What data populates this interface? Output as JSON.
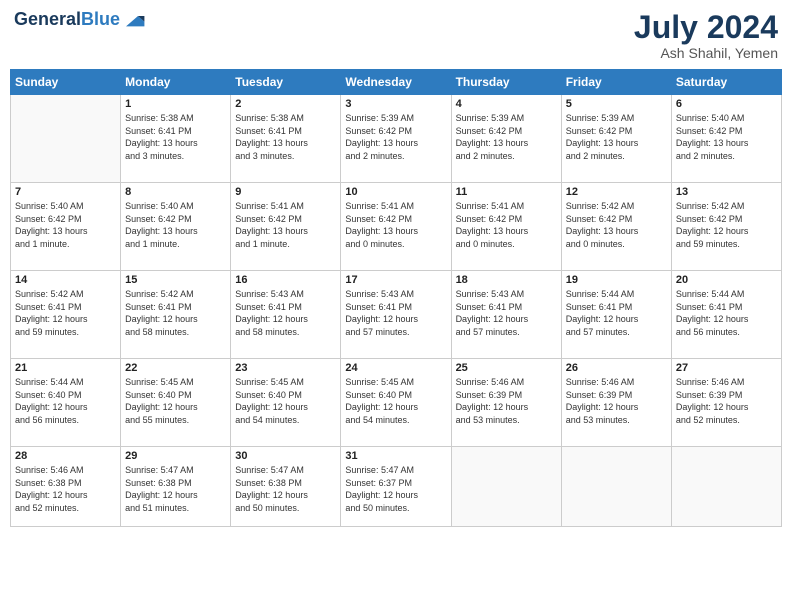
{
  "header": {
    "logo_line1": "General",
    "logo_line2": "Blue",
    "month": "July 2024",
    "location": "Ash Shahil, Yemen"
  },
  "days_of_week": [
    "Sunday",
    "Monday",
    "Tuesday",
    "Wednesday",
    "Thursday",
    "Friday",
    "Saturday"
  ],
  "weeks": [
    [
      {
        "day": "",
        "info": ""
      },
      {
        "day": "1",
        "info": "Sunrise: 5:38 AM\nSunset: 6:41 PM\nDaylight: 13 hours\nand 3 minutes."
      },
      {
        "day": "2",
        "info": "Sunrise: 5:38 AM\nSunset: 6:41 PM\nDaylight: 13 hours\nand 3 minutes."
      },
      {
        "day": "3",
        "info": "Sunrise: 5:39 AM\nSunset: 6:42 PM\nDaylight: 13 hours\nand 2 minutes."
      },
      {
        "day": "4",
        "info": "Sunrise: 5:39 AM\nSunset: 6:42 PM\nDaylight: 13 hours\nand 2 minutes."
      },
      {
        "day": "5",
        "info": "Sunrise: 5:39 AM\nSunset: 6:42 PM\nDaylight: 13 hours\nand 2 minutes."
      },
      {
        "day": "6",
        "info": "Sunrise: 5:40 AM\nSunset: 6:42 PM\nDaylight: 13 hours\nand 2 minutes."
      }
    ],
    [
      {
        "day": "7",
        "info": "Sunrise: 5:40 AM\nSunset: 6:42 PM\nDaylight: 13 hours\nand 1 minute."
      },
      {
        "day": "8",
        "info": "Sunrise: 5:40 AM\nSunset: 6:42 PM\nDaylight: 13 hours\nand 1 minute."
      },
      {
        "day": "9",
        "info": "Sunrise: 5:41 AM\nSunset: 6:42 PM\nDaylight: 13 hours\nand 1 minute."
      },
      {
        "day": "10",
        "info": "Sunrise: 5:41 AM\nSunset: 6:42 PM\nDaylight: 13 hours\nand 0 minutes."
      },
      {
        "day": "11",
        "info": "Sunrise: 5:41 AM\nSunset: 6:42 PM\nDaylight: 13 hours\nand 0 minutes."
      },
      {
        "day": "12",
        "info": "Sunrise: 5:42 AM\nSunset: 6:42 PM\nDaylight: 13 hours\nand 0 minutes."
      },
      {
        "day": "13",
        "info": "Sunrise: 5:42 AM\nSunset: 6:42 PM\nDaylight: 12 hours\nand 59 minutes."
      }
    ],
    [
      {
        "day": "14",
        "info": "Sunrise: 5:42 AM\nSunset: 6:41 PM\nDaylight: 12 hours\nand 59 minutes."
      },
      {
        "day": "15",
        "info": "Sunrise: 5:42 AM\nSunset: 6:41 PM\nDaylight: 12 hours\nand 58 minutes."
      },
      {
        "day": "16",
        "info": "Sunrise: 5:43 AM\nSunset: 6:41 PM\nDaylight: 12 hours\nand 58 minutes."
      },
      {
        "day": "17",
        "info": "Sunrise: 5:43 AM\nSunset: 6:41 PM\nDaylight: 12 hours\nand 57 minutes."
      },
      {
        "day": "18",
        "info": "Sunrise: 5:43 AM\nSunset: 6:41 PM\nDaylight: 12 hours\nand 57 minutes."
      },
      {
        "day": "19",
        "info": "Sunrise: 5:44 AM\nSunset: 6:41 PM\nDaylight: 12 hours\nand 57 minutes."
      },
      {
        "day": "20",
        "info": "Sunrise: 5:44 AM\nSunset: 6:41 PM\nDaylight: 12 hours\nand 56 minutes."
      }
    ],
    [
      {
        "day": "21",
        "info": "Sunrise: 5:44 AM\nSunset: 6:40 PM\nDaylight: 12 hours\nand 56 minutes."
      },
      {
        "day": "22",
        "info": "Sunrise: 5:45 AM\nSunset: 6:40 PM\nDaylight: 12 hours\nand 55 minutes."
      },
      {
        "day": "23",
        "info": "Sunrise: 5:45 AM\nSunset: 6:40 PM\nDaylight: 12 hours\nand 54 minutes."
      },
      {
        "day": "24",
        "info": "Sunrise: 5:45 AM\nSunset: 6:40 PM\nDaylight: 12 hours\nand 54 minutes."
      },
      {
        "day": "25",
        "info": "Sunrise: 5:46 AM\nSunset: 6:39 PM\nDaylight: 12 hours\nand 53 minutes."
      },
      {
        "day": "26",
        "info": "Sunrise: 5:46 AM\nSunset: 6:39 PM\nDaylight: 12 hours\nand 53 minutes."
      },
      {
        "day": "27",
        "info": "Sunrise: 5:46 AM\nSunset: 6:39 PM\nDaylight: 12 hours\nand 52 minutes."
      }
    ],
    [
      {
        "day": "28",
        "info": "Sunrise: 5:46 AM\nSunset: 6:38 PM\nDaylight: 12 hours\nand 52 minutes."
      },
      {
        "day": "29",
        "info": "Sunrise: 5:47 AM\nSunset: 6:38 PM\nDaylight: 12 hours\nand 51 minutes."
      },
      {
        "day": "30",
        "info": "Sunrise: 5:47 AM\nSunset: 6:38 PM\nDaylight: 12 hours\nand 50 minutes."
      },
      {
        "day": "31",
        "info": "Sunrise: 5:47 AM\nSunset: 6:37 PM\nDaylight: 12 hours\nand 50 minutes."
      },
      {
        "day": "",
        "info": ""
      },
      {
        "day": "",
        "info": ""
      },
      {
        "day": "",
        "info": ""
      }
    ]
  ]
}
